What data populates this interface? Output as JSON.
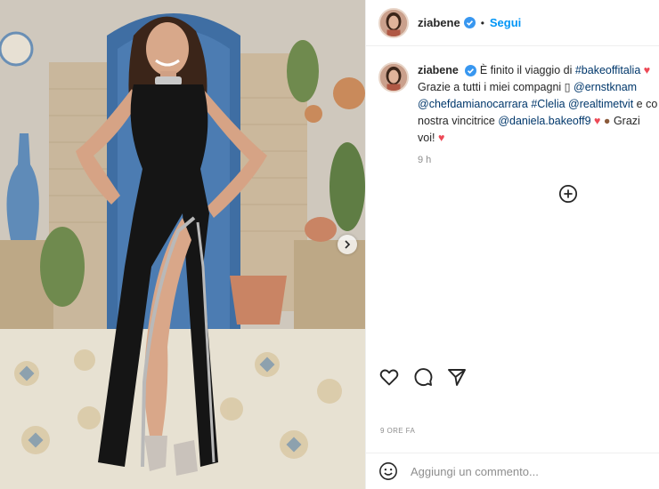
{
  "post": {
    "username": "ziabene",
    "follow_label": "Segui",
    "separator": "•",
    "caption": {
      "part1": "È finito il viaggio di ",
      "tag_bakeoff": "#bakeoffitalia",
      "line2_prefix": "Grazie a tutti i miei compagni ",
      "mention_ernst": "@ernstknam",
      "mention_chef": "@chefdamianocarrara",
      "tag_clelia": "#Clelia",
      "mention_realtime": "@realtimetvit",
      "line3_suffix": " e co",
      "line4_prefix": "nostra vincitrice ",
      "mention_daniela": "@daniela.bakeoff9",
      "line4_suffix": " Grazi",
      "line5": "voi! "
    },
    "time_short": "9 h",
    "time_ago": "9 ORE FA",
    "comment_placeholder": "Aggiungi un commento...",
    "icons": {
      "verified": "verified-badge-icon",
      "like": "heart-icon",
      "comment": "comment-icon",
      "share": "send-icon",
      "more": "plus-circle-icon",
      "emoji": "smiley-icon",
      "next": "chevron-right-icon"
    },
    "colors": {
      "link": "#00376b",
      "follow": "#0095f6",
      "verified": "#3897f0",
      "heart": "#ed4956"
    }
  }
}
